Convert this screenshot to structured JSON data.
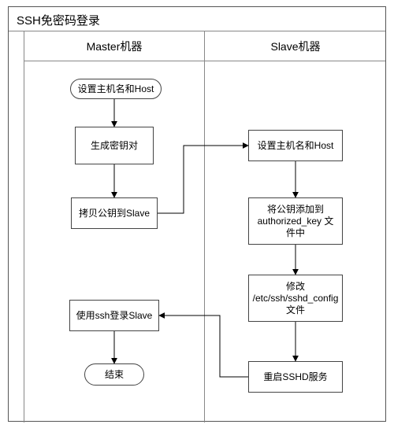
{
  "diagram": {
    "title": "SSH免密码登录",
    "columns": {
      "left": "Master机器",
      "right": "Slave机器"
    },
    "nodes": {
      "start": {
        "label": "设置主机名和Host",
        "shape": "terminator",
        "column": "left"
      },
      "genkey": {
        "label": "生成密钥对",
        "shape": "process",
        "column": "left"
      },
      "copykey": {
        "label": "拷贝公钥到Slave",
        "shape": "process",
        "column": "left"
      },
      "sethost": {
        "label": "设置主机名和Host",
        "shape": "process",
        "column": "right"
      },
      "authkey": {
        "label": "将公钥添加到 authorized_key 文件中",
        "shape": "process",
        "column": "right"
      },
      "sshdconf": {
        "label": "修改 /etc/ssh/sshd_config文件",
        "shape": "process",
        "column": "right"
      },
      "restart": {
        "label": "重启SSHD服务",
        "shape": "process",
        "column": "right"
      },
      "login": {
        "label": "使用ssh登录Slave",
        "shape": "process",
        "column": "left"
      },
      "end": {
        "label": "结束",
        "shape": "terminator",
        "column": "left"
      }
    },
    "edges": [
      {
        "from": "start",
        "to": "genkey"
      },
      {
        "from": "genkey",
        "to": "copykey"
      },
      {
        "from": "copykey",
        "to": "sethost"
      },
      {
        "from": "sethost",
        "to": "authkey"
      },
      {
        "from": "authkey",
        "to": "sshdconf"
      },
      {
        "from": "sshdconf",
        "to": "restart"
      },
      {
        "from": "restart",
        "to": "login"
      },
      {
        "from": "login",
        "to": "end"
      }
    ]
  }
}
